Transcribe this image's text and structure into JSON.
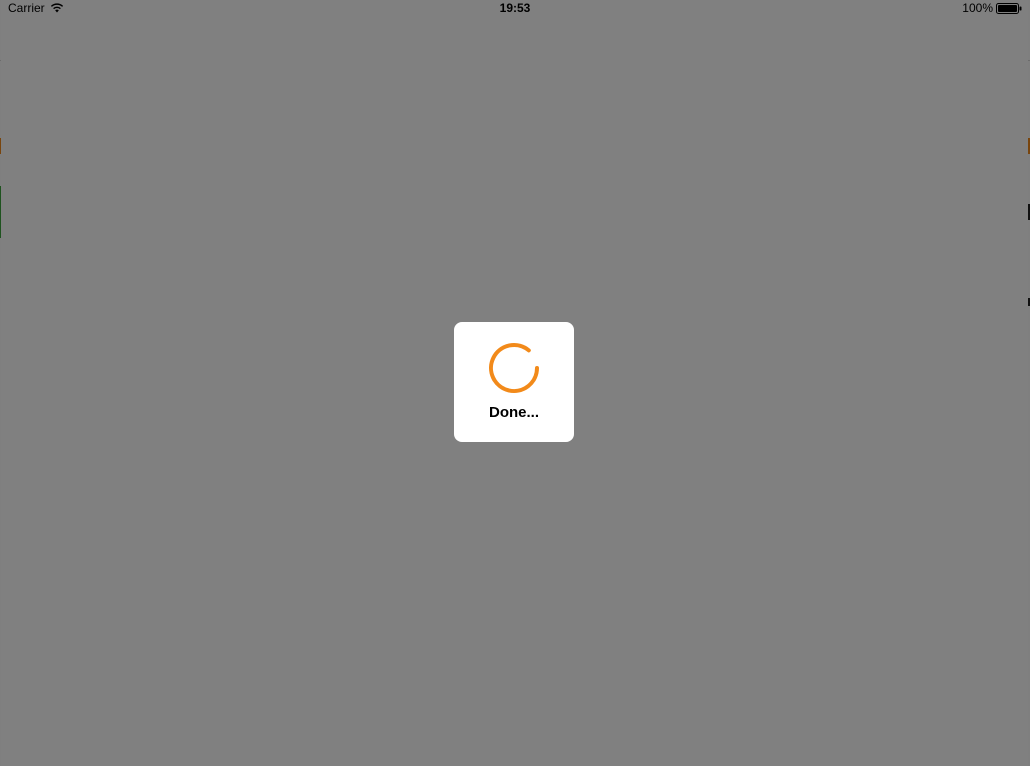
{
  "status_bar": {
    "carrier": "Carrier",
    "time": "19:53",
    "battery": "100%"
  },
  "hud": {
    "label": "Done...",
    "spinner_icon": "spinner-icon",
    "accent_color": "#f28a1a"
  },
  "overlay": {
    "color": "#808080"
  },
  "icons": {
    "wifi": "wifi-icon",
    "battery": "battery-icon"
  }
}
